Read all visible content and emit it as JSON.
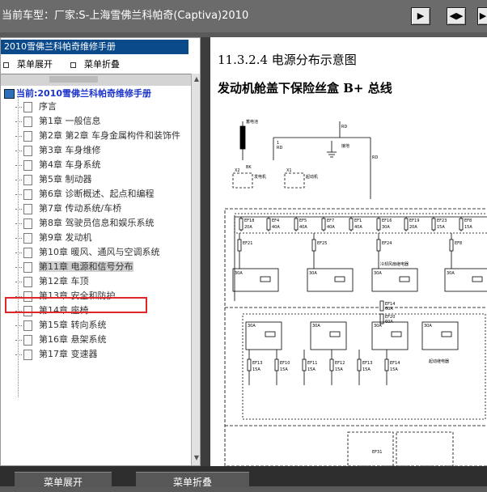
{
  "window": {
    "title": "当前车型：厂家:S-上海雪佛兰科帕奇(Captiva)2010",
    "buttons": [
      "▶",
      "◀▶",
      "▶"
    ]
  },
  "sidebar": {
    "header": "2010雪佛兰科帕奇维修手册",
    "expand_label": "菜单展开",
    "collapse_label": "菜单折叠",
    "root_label": "当前:2010雪佛兰科帕奇维修手册",
    "items": [
      {
        "label": "序言"
      },
      {
        "label": "第1章  一般信息"
      },
      {
        "label": "第2章  第2章  车身金属构件和装饰件"
      },
      {
        "label": "第3章  车身维修"
      },
      {
        "label": "第4章  车身系统"
      },
      {
        "label": "第5章  制动器"
      },
      {
        "label": "第6章  诊断概述、起点和编程"
      },
      {
        "label": "第7章  传动系统/车桥"
      },
      {
        "label": "第8章  驾驶员信息和娱乐系统"
      },
      {
        "label": "第9章  发动机"
      },
      {
        "label": "第10章  暖风、通风与空调系统"
      },
      {
        "label": "第11章  电源和信号分布",
        "selected": true
      },
      {
        "label": "第12章  车顶"
      },
      {
        "label": "第13章  安全和防护"
      },
      {
        "label": "第14章  座椅"
      },
      {
        "label": "第15章  转向系统"
      },
      {
        "label": "第16章  悬架系统"
      },
      {
        "label": "第17章  变速器"
      }
    ]
  },
  "content": {
    "section_title": "11.3.2.4  电源分布示意图",
    "subtitle": "发动机舱盖下保险丝盒  B+  总线"
  },
  "diagram": {
    "labels": {
      "battery": "蓄电池",
      "starter": "起动机",
      "generator": "发电机",
      "ground": "接地",
      "bk": "BK",
      "rd": "RD",
      "one": "1",
      "x1": "X1",
      "x2": "X2",
      "ef18": "EF18",
      "ef4": "EF4",
      "ef5": "EF5",
      "ef7": "EF7",
      "ef1": "EF1",
      "ef16": "EF16",
      "ef19": "EF19",
      "ef23": "EF23",
      "ef8": "EF8",
      "ef21": "EF21",
      "ef25": "EF25",
      "ef24": "EF24",
      "ef14": "EF14",
      "ef10": "EF10",
      "ef11": "EF11",
      "ef12": "EF12",
      "ef13": "EF13",
      "ef20": "EF20",
      "ef31": "EF31",
      "amps_15": "15A",
      "amps_20": "20A",
      "amps_30": "30A",
      "amps_40": "40A",
      "amps_60": "60A",
      "relay_fan": "冷却风扇继电器",
      "relay_starter": "起动继电器"
    }
  },
  "footer": {
    "expand_label": "菜单展开",
    "collapse_label": "菜单折叠"
  },
  "colors": {
    "titlebar": "#6b6b6b",
    "tree_header": "#0a4a8a",
    "root_text": "#1a33cc",
    "highlight_box": "#e0262b"
  }
}
